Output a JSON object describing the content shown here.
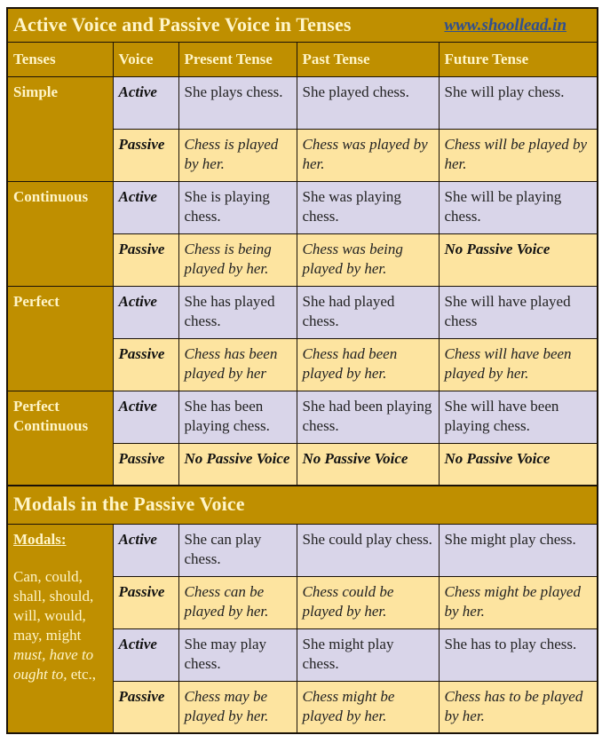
{
  "tenses_table": {
    "title": "Active Voice and Passive Voice in Tenses",
    "site_link": "www.shoollead.in",
    "headers": [
      "Tenses",
      "Voice",
      "Present Tense",
      "Past Tense",
      "Future Tense"
    ],
    "groups": [
      {
        "tense": "Simple",
        "active": {
          "voice": "Active",
          "present": "She plays chess.",
          "past": "She played chess.",
          "future": "She will play chess."
        },
        "passive": {
          "voice": "Passive",
          "present": "Chess is played by her.",
          "past": "Chess was played by her.",
          "future": "Chess will be played by her."
        }
      },
      {
        "tense": "Continuous",
        "active": {
          "voice": "Active",
          "present": "She is playing chess.",
          "past": "She was playing chess.",
          "future": "She will be playing chess."
        },
        "passive": {
          "voice": "Passive",
          "present": "Chess is being played by her.",
          "past": "Chess was being played by her.",
          "future": "No Passive Voice"
        }
      },
      {
        "tense": "Perfect",
        "active": {
          "voice": "Active",
          "present": "She has played chess.",
          "past": "She had played chess.",
          "future": "She will have played chess"
        },
        "passive": {
          "voice": "Passive",
          "present": "Chess has been played by her",
          "past": "Chess had been played by her.",
          "future": "Chess will have been played by her."
        }
      },
      {
        "tense": "Perfect Continuous",
        "active": {
          "voice": "Active",
          "present": "She has been playing chess.",
          "past": "She had been playing chess.",
          "future": "She will have been playing chess."
        },
        "passive": {
          "voice": "Passive",
          "present": "No Passive Voice",
          "past": "No Passive Voice",
          "future": "No Passive Voice"
        }
      }
    ]
  },
  "modals_table": {
    "title": "Modals in the Passive Voice",
    "modals_heading": "Modals:",
    "modals_list_plain": "Can, could, shall, should, will, would, may, might",
    "modals_list_italic": "must, have to ought to,",
    "modals_list_tail": " etc.,",
    "rows": [
      {
        "voice": "Active",
        "col1": "She can play chess.",
        "col2": "She could play chess.",
        "col3": "She might play chess."
      },
      {
        "voice": "Passive",
        "col1": "Chess can be played by her.",
        "col2": "Chess could be played by her.",
        "col3": "Chess might be played by her."
      },
      {
        "voice": "Active",
        "col1": "She may play chess.",
        "col2": "She might play chess.",
        "col3": "She has to play chess."
      },
      {
        "voice": "Passive",
        "col1": "Chess may be played by her.",
        "col2": "Chess might be played by her.",
        "col3": "Chess has to be played by her."
      }
    ]
  },
  "colors": {
    "header_gold": "#bf8f00",
    "header_text": "#fff5c8",
    "active_row": "#d9d5e9",
    "passive_row": "#fde4a0",
    "link": "#2f4f8f"
  }
}
